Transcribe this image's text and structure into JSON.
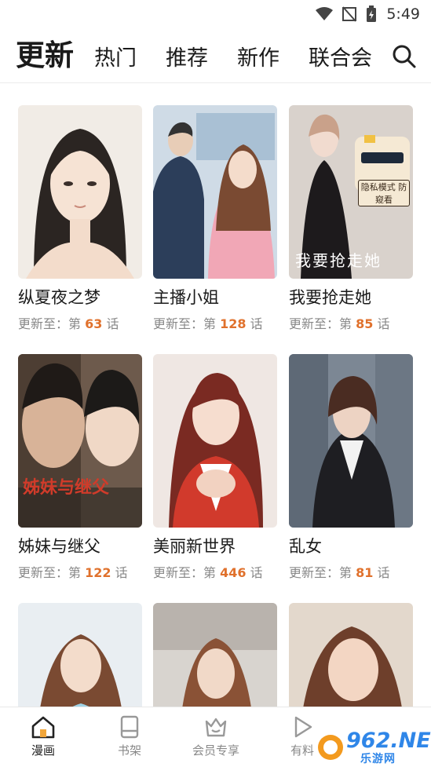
{
  "status_bar": {
    "time": "5:49"
  },
  "header": {
    "tabs": [
      {
        "label": "更新",
        "active": true
      },
      {
        "label": "热门",
        "active": false
      },
      {
        "label": "推荐",
        "active": false
      },
      {
        "label": "新作",
        "active": false
      },
      {
        "label": "联合会",
        "active": false
      }
    ]
  },
  "update_prefix": "更新至：",
  "chapter_prefix": "第",
  "chapter_suffix": "话",
  "comics": [
    {
      "title": "纵夏夜之梦",
      "chapter": "63"
    },
    {
      "title": "主播小姐",
      "chapter": "128"
    },
    {
      "title": "我要抢走她",
      "chapter": "85",
      "cover_text": "我要抢走她",
      "badge_text": "隐私模式 防窥看"
    },
    {
      "title": "姊妹与继父",
      "chapter": "122",
      "cover_text": "姊妹与继父"
    },
    {
      "title": "美丽新世界",
      "chapter": "446"
    },
    {
      "title": "乱女",
      "chapter": "81"
    },
    {
      "title": "",
      "chapter": ""
    },
    {
      "title": "",
      "chapter": ""
    },
    {
      "title": "",
      "chapter": ""
    }
  ],
  "bottom_nav": [
    {
      "label": "漫画",
      "active": true
    },
    {
      "label": "书架",
      "active": false
    },
    {
      "label": "会员专享",
      "active": false
    },
    {
      "label": "有料",
      "active": false
    }
  ],
  "watermark": {
    "brand": "962.NET",
    "sub": "乐游网"
  },
  "colors": {
    "accent": "#e0712c",
    "text": "#1a1a1a",
    "muted": "#888888"
  }
}
